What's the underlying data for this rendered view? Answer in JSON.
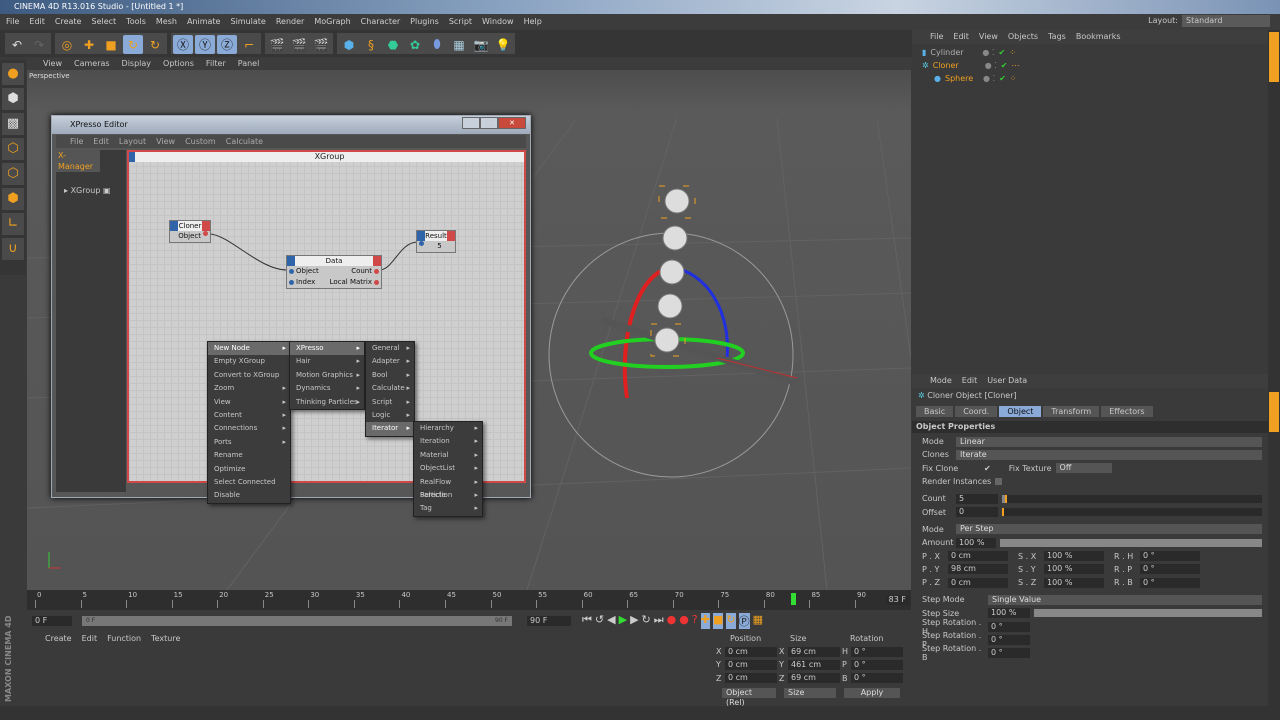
{
  "app": {
    "title": "CINEMA 4D R13.016 Studio - [Untitled 1 *]",
    "menu": [
      "File",
      "Edit",
      "Create",
      "Select",
      "Tools",
      "Mesh",
      "Animate",
      "Simulate",
      "Render",
      "MoGraph",
      "Character",
      "Plugins",
      "Script",
      "Window",
      "Help"
    ],
    "layout_label": "Layout:",
    "layout_value": "Standard"
  },
  "viewport": {
    "menu": [
      "View",
      "Cameras",
      "Display",
      "Options",
      "Filter",
      "Panel"
    ],
    "name": "Perspective"
  },
  "xpresso": {
    "title": "XPresso Editor",
    "menu": [
      "File",
      "Edit",
      "Layout",
      "View",
      "Custom",
      "Calculate"
    ],
    "manager_tab": "X-Manager",
    "tree_item": "XGroup",
    "group_title": "XGroup",
    "nodes": {
      "cloner": {
        "title": "Cloner",
        "out": "Object"
      },
      "data": {
        "title": "Data",
        "in": [
          "Object",
          "Index"
        ],
        "out": [
          "Count",
          "Local Matrix"
        ]
      },
      "result": {
        "title": "Result",
        "value": "5"
      }
    }
  },
  "context_menu": {
    "main": [
      {
        "label": "New Node",
        "sub": true
      },
      {
        "label": "Empty XGroup"
      },
      {
        "label": "Convert to XGroup"
      },
      {
        "label": "Zoom",
        "sub": true
      },
      {
        "label": "View",
        "sub": true
      },
      {
        "label": "Content",
        "sub": true
      },
      {
        "label": "Connections",
        "sub": true
      },
      {
        "label": "Ports",
        "sub": true
      },
      {
        "label": "Rename"
      },
      {
        "label": "Optimize"
      },
      {
        "label": "Select Connected"
      },
      {
        "label": "Disable"
      }
    ],
    "new_node": [
      "XPresso",
      "Hair",
      "Motion Graphics",
      "Dynamics",
      "Thinking Particles"
    ],
    "xpresso": [
      "General",
      "Adapter",
      "Bool",
      "Calculate",
      "Script",
      "Logic",
      "Iterator"
    ],
    "iterator": [
      "Hierarchy",
      "Iteration",
      "Material",
      "ObjectList",
      "RealFlow Particle",
      "Selection",
      "Tag"
    ]
  },
  "object_manager": {
    "menu": [
      "File",
      "Edit",
      "View",
      "Objects",
      "Tags",
      "Bookmarks"
    ],
    "objects": [
      {
        "name": "Cylinder",
        "color": "#b0b0b0"
      },
      {
        "name": "Cloner",
        "color": "#f0a020"
      },
      {
        "name": "Sphere",
        "color": "#f0a020"
      }
    ]
  },
  "attributes": {
    "menu": [
      "Mode",
      "Edit",
      "User Data"
    ],
    "object_title": "Cloner Object [Cloner]",
    "tabs": [
      "Basic",
      "Coord.",
      "Object",
      "Transform",
      "Effectors"
    ],
    "active_tab": "Object",
    "section": "Object Properties",
    "mode_label": "Mode",
    "mode_value": "Linear",
    "clones_label": "Clones",
    "clones_value": "Iterate",
    "fix_clone": "Fix Clone",
    "fix_texture": "Fix Texture",
    "fix_texture_value": "Off",
    "render_instances": "Render Instances",
    "count_label": "Count",
    "count_value": "5",
    "offset_label": "Offset",
    "offset_value": "0",
    "mode2_label": "Mode",
    "mode2_value": "Per Step",
    "amount_label": "Amount",
    "amount_value": "100 %",
    "grid": [
      [
        "P . X",
        "0 cm",
        "S . X",
        "100 %",
        "R . H",
        "0 °"
      ],
      [
        "P . Y",
        "98 cm",
        "S . Y",
        "100 %",
        "R . P",
        "0 °"
      ],
      [
        "P . Z",
        "0 cm",
        "S . Z",
        "100 %",
        "R . B",
        "0 °"
      ]
    ],
    "step_mode_label": "Step Mode",
    "step_mode_value": "Single Value",
    "step_size_label": "Step Size",
    "step_size_value": "100 %",
    "step_rot": [
      [
        "Step Rotation . H",
        "0 °"
      ],
      [
        "Step Rotation . P",
        "0 °"
      ],
      [
        "Step Rotation . B",
        "0 °"
      ]
    ]
  },
  "timeline": {
    "ticks": [
      "0",
      "5",
      "10",
      "15",
      "20",
      "25",
      "30",
      "35",
      "40",
      "45",
      "50",
      "55",
      "60",
      "65",
      "70",
      "75",
      "80",
      "85",
      "90"
    ],
    "current": "83",
    "current_field": "83 F",
    "start": "0 F",
    "end": "90 F",
    "range_start": "0 F",
    "range_end": "90 F",
    "current_frame_fraction": 0.922
  },
  "material_manager": {
    "menu": [
      "Create",
      "Edit",
      "Function",
      "Texture"
    ]
  },
  "coordinates": {
    "headers": [
      "Position",
      "Size",
      "Rotation"
    ],
    "rows": [
      [
        "X",
        "0 cm",
        "X",
        "69 cm",
        "H",
        "0 °"
      ],
      [
        "Y",
        "0 cm",
        "Y",
        "461 cm",
        "P",
        "0 °"
      ],
      [
        "Z",
        "0 cm",
        "Z",
        "69 cm",
        "B",
        "0 °"
      ]
    ],
    "mode": "Object (Rel)",
    "size_mode": "Size",
    "apply": "Apply"
  },
  "brand": "MAXON CINEMA 4D"
}
